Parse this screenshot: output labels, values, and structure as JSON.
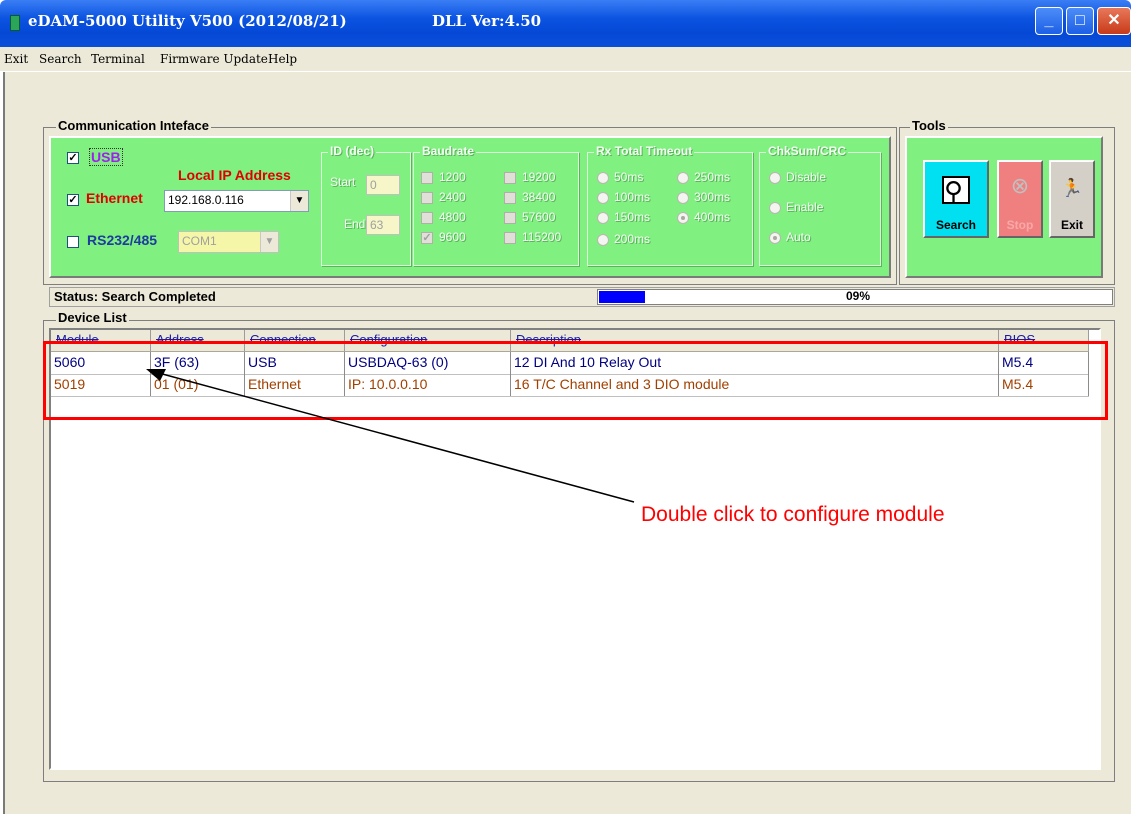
{
  "window": {
    "title": "eDAM-5000 Utility  V500 (2012/08/21)",
    "dll_version": "DLL Ver:4.50"
  },
  "menu": [
    "Exit",
    "Search",
    "Terminal",
    "Firmware Update",
    "Help"
  ],
  "comm": {
    "group_label": "Communication Inteface",
    "usb": {
      "label": "USB",
      "checked": true
    },
    "ethernet": {
      "label": "Ethernet",
      "checked": true
    },
    "local_ip_label": "Local IP Address",
    "ip_value": "192.168.0.116",
    "rs232": {
      "label": "RS232/485",
      "checked": false
    },
    "com_value": "COM1",
    "id": {
      "label": "ID (dec)",
      "start_label": "Start",
      "start_value": "0",
      "end_label": "End",
      "end_value": "63"
    },
    "baudrate": {
      "label": "Baudrate",
      "options": [
        {
          "label": "1200",
          "checked": false
        },
        {
          "label": "19200",
          "checked": false
        },
        {
          "label": "2400",
          "checked": false
        },
        {
          "label": "38400",
          "checked": false
        },
        {
          "label": "4800",
          "checked": false
        },
        {
          "label": "57600",
          "checked": false
        },
        {
          "label": "9600",
          "checked": true
        },
        {
          "label": "115200",
          "checked": false
        }
      ]
    },
    "timeout": {
      "label": "Rx Total Timeout",
      "options": [
        {
          "label": "50ms",
          "selected": false
        },
        {
          "label": "250ms",
          "selected": false
        },
        {
          "label": "100ms",
          "selected": false
        },
        {
          "label": "300ms",
          "selected": false
        },
        {
          "label": "150ms",
          "selected": false
        },
        {
          "label": "400ms",
          "selected": true
        },
        {
          "label": "200ms",
          "selected": false
        }
      ]
    },
    "chksum": {
      "label": "ChkSum/CRC",
      "options": [
        {
          "label": "Disable",
          "selected": false
        },
        {
          "label": "Enable",
          "selected": false
        },
        {
          "label": "Auto",
          "selected": true
        }
      ]
    }
  },
  "tools": {
    "label": "Tools",
    "search": {
      "label": "Search",
      "icon": "magnifier-icon",
      "color": "#00e0f0"
    },
    "stop": {
      "label": "Stop",
      "icon": "stop-magnifier-icon",
      "color": "#f08080"
    },
    "exit": {
      "label": "Exit",
      "icon": "running-man-icon",
      "color": "#d4d0c8"
    }
  },
  "status": {
    "text": "Status: Search Completed",
    "progress_fraction": 0.09,
    "progress_label": "09%",
    "bar_color": "#0000ff"
  },
  "device_list": {
    "label": "Device List",
    "columns": [
      "Module",
      "Address",
      "Connection",
      "Configuration",
      "Description",
      "BIOS"
    ],
    "rows": [
      {
        "module": "5060",
        "address": "3F (63)",
        "connection": "USB",
        "configuration": "USBDAQ-63 (0)",
        "description": "12 DI And 10 Relay Out",
        "bios": "M5.4",
        "color": "#000080"
      },
      {
        "module": "5019",
        "address": "01 (01)",
        "connection": "Ethernet",
        "configuration": "IP: 10.0.0.10",
        "description": "16 T/C Channel and 3 DIO module",
        "bios": "M5.4",
        "color": "#a04000"
      }
    ]
  },
  "annotation": {
    "text": "Double click to configure module",
    "color": "#ff0000"
  }
}
